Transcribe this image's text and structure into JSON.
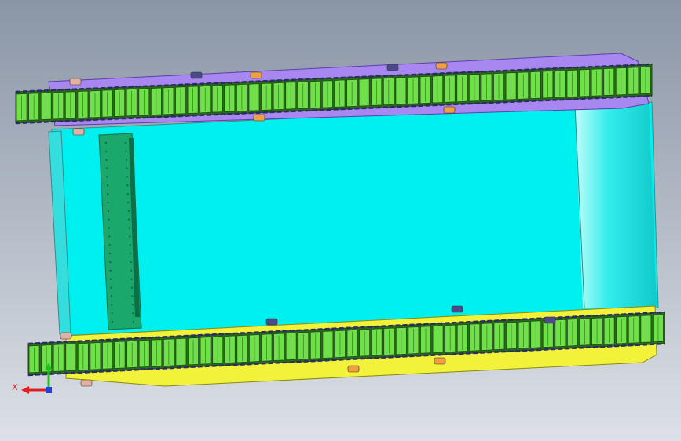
{
  "viewport": {
    "background_top": "#8a95a6",
    "background_bottom": "#dde1e7"
  },
  "colors": {
    "body": "#00f0f0",
    "body_edge": "#3a8a8a",
    "body_shade": "#34dede",
    "panel": "#1ba86c",
    "panel_dark": "#0e6e45",
    "track_green": "#6fe04a",
    "track_dark": "#1d4d12",
    "track_shadow": "#2a6a1a",
    "purple_frame": "#a888f0",
    "purple_dark": "#5b3fa8",
    "yellow_frame": "#f2f23a",
    "yellow_dark": "#8a8a10",
    "axis_x": "#e02020",
    "axis_y": "#20c020",
    "axis_z": "#2040e0"
  },
  "axis_triad": {
    "x_label": "X",
    "x_icon": "x-axis-arrow-icon",
    "y_icon": "y-axis-arrow-icon",
    "z_icon": "z-axis-dot-icon"
  },
  "scene": {
    "model": "tracked-chassis-top-view",
    "upper_track_link_count": 52,
    "lower_track_link_count": 52
  }
}
